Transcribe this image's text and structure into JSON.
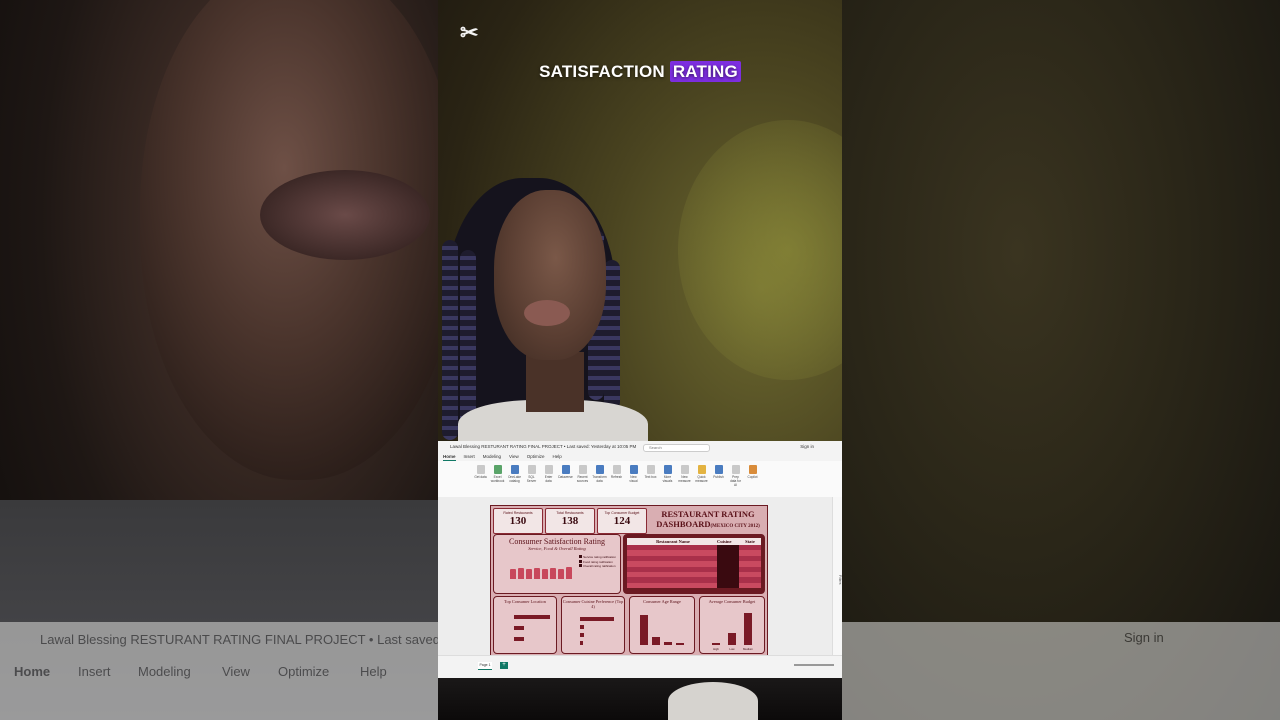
{
  "caption": {
    "part1": "SATISFACTION",
    "part2": "RATING"
  },
  "pbi": {
    "title": "Lawal Blessing RESTURANT RATING FINAL PROJECT • Last saved: Yesterday at 10:05 PM",
    "search": "Search",
    "sign_in": "Sign in",
    "menu": [
      "Home",
      "Insert",
      "Modeling",
      "View",
      "Optimize",
      "Help"
    ],
    "ribbon": [
      "Get data",
      "Excel workbook",
      "OneLake catalog",
      "SQL Server",
      "Enter data",
      "Dataverse",
      "Recent sources",
      "Transform data",
      "Refresh",
      "New visual",
      "Text box",
      "More visuals",
      "New measure",
      "Quick measure",
      "Publish",
      "Prep data for AI",
      "Copilot"
    ],
    "filters_label": "Filters",
    "page_tab": "Page 1"
  },
  "dashboard": {
    "kpis": [
      {
        "label": "Rated Restaurants",
        "value": "130"
      },
      {
        "label": "Total Restaurants",
        "value": "138"
      },
      {
        "label": "Top Consumer Budget",
        "value": "124"
      }
    ],
    "title_line1": "RESTAURANT RATING",
    "title_line2": "DASHBOARD",
    "title_sub": "(MEXICO CITY 2012)",
    "satisfaction": {
      "title": "Consumer Satisfaction Rating",
      "subtitle": "Service, Food & Overall Rating",
      "legend": [
        "Service rating ratification",
        "Food rating ratification",
        "Overall rating ratification"
      ]
    },
    "table": {
      "headers": [
        "Restaurant Name",
        "Cuisine",
        "State"
      ],
      "rows": [
        [
          "",
          "",
          ""
        ],
        [
          "",
          "",
          ""
        ],
        [
          "",
          "",
          ""
        ],
        [
          "",
          "",
          ""
        ],
        [
          "",
          "",
          ""
        ],
        [
          "",
          "",
          ""
        ],
        [
          "",
          "",
          ""
        ],
        [
          "",
          "",
          ""
        ]
      ]
    },
    "locations": {
      "title": "Top Consumer Location",
      "labels": [
        "",
        "",
        ""
      ]
    },
    "cuisine": {
      "title": "Consumer Cuisine Preference (Top 4)",
      "labels": [
        "",
        "",
        "",
        ""
      ]
    },
    "age": {
      "title": "Consumer Age Range",
      "labels": [
        "",
        "",
        "",
        ""
      ]
    },
    "budget": {
      "title": "Average Consumer Budget",
      "labels": [
        "High",
        "Low",
        "Medium"
      ]
    }
  },
  "bottom_left": {
    "title": "Lawal Blessing RESTURANT RATING FINAL PROJECT • Last saved: Yesterd",
    "menu": [
      "Home",
      "Insert",
      "Modeling",
      "View",
      "Optimize",
      "Help"
    ]
  },
  "bottom_right": {
    "sign_in": "Sign in"
  },
  "colors": {
    "accent_highlight": "#7d2ee0",
    "dashboard_maroon": "#6b1a22",
    "pbi_green": "#117865"
  }
}
